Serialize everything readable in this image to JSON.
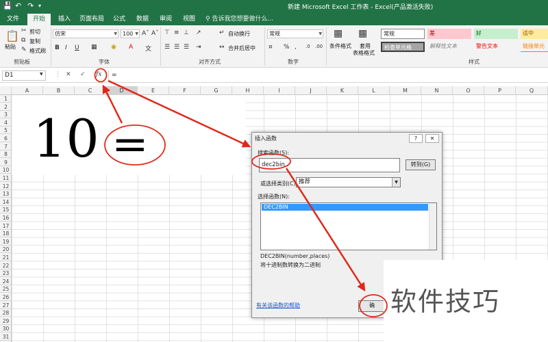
{
  "titlebar": {
    "title": "新建 Microsoft Excel 工作表 - Excel(产品激活失败)",
    "save_icon": "save-icon",
    "undo_icon": "undo-icon",
    "redo_icon": "redo-icon"
  },
  "tabs": [
    "文件",
    "开始",
    "插入",
    "页面布局",
    "公式",
    "数据",
    "审阅",
    "视图"
  ],
  "active_tab": "开始",
  "tell_me": "告诉我您想要做什么...",
  "clipboard": {
    "paste": "粘贴",
    "cut": "剪切",
    "copy": "复制",
    "format_painter": "格式刷",
    "label": "剪贴板"
  },
  "font": {
    "name": "仿宋",
    "size": "100",
    "bold": "B",
    "italic": "I",
    "underline": "U",
    "label": "字体"
  },
  "alignment": {
    "wrap": "自动换行",
    "merge": "合并后居中",
    "label": "对齐方式"
  },
  "number": {
    "format": "常规",
    "label": "数字"
  },
  "styles": {
    "conditional": "条件格式",
    "table": "套用",
    "table2": "表格格式",
    "normal": "常规",
    "bad": "差",
    "good": "好",
    "neutral": "适中",
    "check": "检查单元格",
    "explain": "解释性文本",
    "warning": "警告文本",
    "link": "链接单元",
    "label": "样式"
  },
  "formula_bar": {
    "name_box": "D1",
    "cancel": "✕",
    "enter": "✓",
    "fx": "fx",
    "content": "="
  },
  "columns": [
    "A",
    "B",
    "C",
    "D",
    "E",
    "F",
    "G",
    "H",
    "I",
    "J",
    "K",
    "L",
    "M",
    "N",
    "O",
    "P",
    "Q"
  ],
  "rows": [
    "1",
    "2",
    "3",
    "4",
    "5",
    "6",
    "7",
    "8",
    "9",
    "10",
    "11",
    "12",
    "13",
    "14",
    "15",
    "16",
    "17",
    "18",
    "19",
    "20",
    "21",
    "22",
    "23",
    "24",
    "25",
    "26",
    "27",
    "28",
    "29",
    "30",
    "31"
  ],
  "cells": {
    "big_number": "10",
    "equals": "="
  },
  "dialog": {
    "title": "插入函数",
    "help": "?",
    "close": "✕",
    "search_label": "搜索函数(S):",
    "search_value": "dec2bin",
    "go_button": "转到(G)",
    "category_label": "或选择类别(C):",
    "category_value": "推荐",
    "select_label": "选择函数(N):",
    "functions": [
      "DEC2BIN"
    ],
    "signature": "DEC2BIN(number,places)",
    "description": "将十进制数转换为二进制",
    "help_link": "有关该函数的帮助",
    "ok_button": "确"
  },
  "watermark": "软件技巧",
  "annotation_color": "#e0281a"
}
